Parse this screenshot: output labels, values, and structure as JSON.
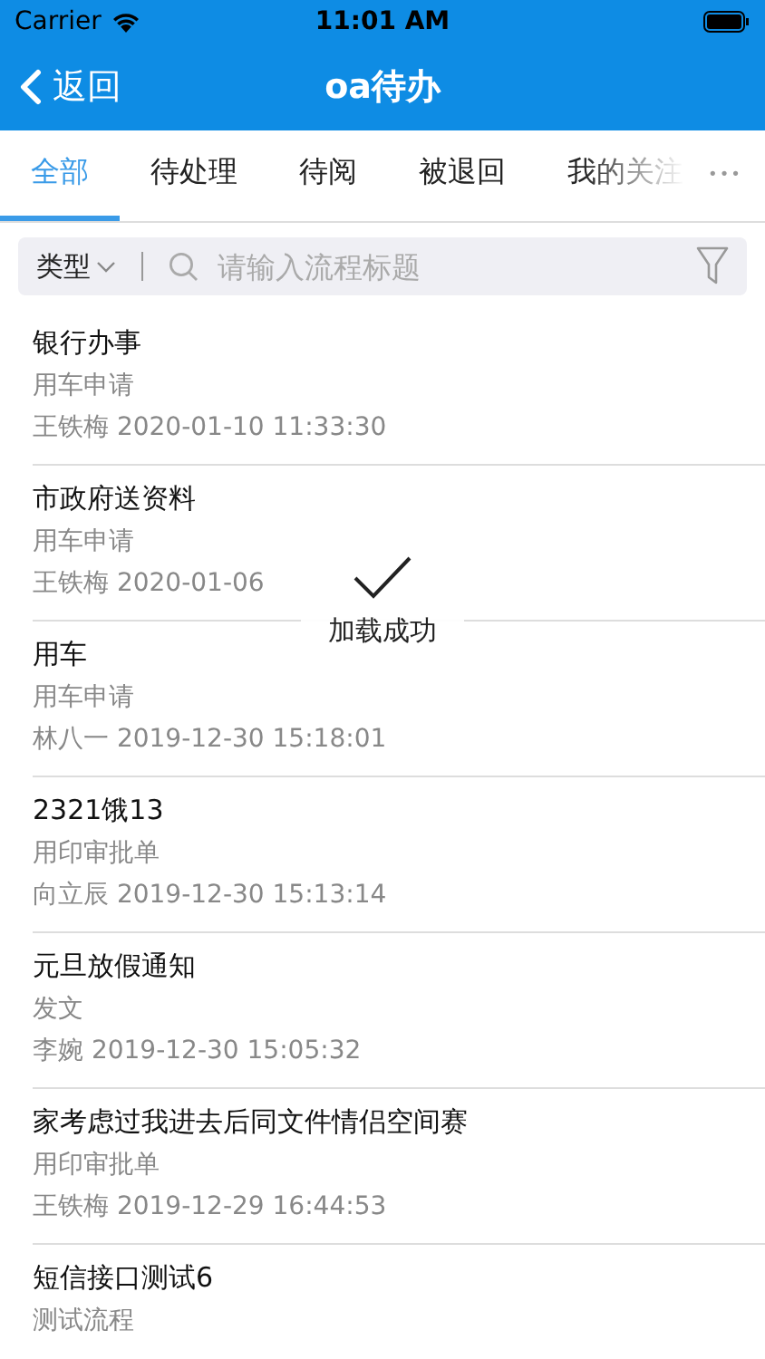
{
  "status_bar": {
    "carrier": "Carrier",
    "time": "11:01 AM"
  },
  "nav": {
    "back": "返回",
    "title": "oa待办"
  },
  "tabs": [
    {
      "label": "全部",
      "selected": true
    },
    {
      "label": "待处理",
      "selected": false
    },
    {
      "label": "待阅",
      "selected": false
    },
    {
      "label": "被退回",
      "selected": false
    },
    {
      "label": "我的关注",
      "selected": false
    }
  ],
  "more": "•••",
  "search": {
    "type_label": "类型",
    "placeholder": "请输入流程标题"
  },
  "items": [
    {
      "title": "银行办事",
      "type": "用车申请",
      "meta": "王铁梅 2020-01-10 11:33:30"
    },
    {
      "title": "市政府送资料",
      "type": "用车申请",
      "meta": "王铁梅 2020-01-06"
    },
    {
      "title": "用车",
      "type": "用车申请",
      "meta": "林八一 2019-12-30 15:18:01"
    },
    {
      "title": "2321饿13",
      "type": "用印审批单",
      "meta": "向立辰 2019-12-30 15:13:14"
    },
    {
      "title": "元旦放假通知",
      "type": "发文",
      "meta": "李婉 2019-12-30 15:05:32"
    },
    {
      "title": "家考虑过我进去后同文件情侣空间赛",
      "type": "用印审批单",
      "meta": "王铁梅 2019-12-29 16:44:53"
    },
    {
      "title": "短信接口测试6",
      "type": "测试流程"
    }
  ],
  "toast": {
    "message": "加载成功"
  }
}
